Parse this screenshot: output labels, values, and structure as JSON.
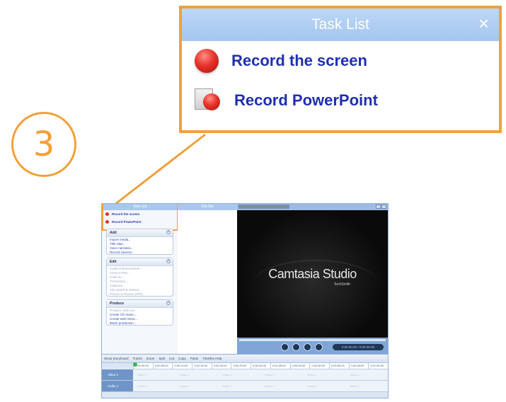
{
  "step": {
    "number": "3"
  },
  "callout": {
    "title": "Task List",
    "close_glyph": "×",
    "tasks": [
      {
        "label": "Record the screen",
        "icon": "record-icon"
      },
      {
        "label": "Record PowerPoint",
        "icon": "powerpoint-record-icon"
      }
    ]
  },
  "colors": {
    "highlight": "#f0a03c",
    "header_blue": "#a6c6ef",
    "task_text": "#1f2fb0",
    "record_red": "#e8312a"
  },
  "app": {
    "task_list_header": "Task List",
    "tasks": [
      "Record the screen",
      "Record PowerPoint"
    ],
    "groups": [
      {
        "title": "Add",
        "items": [
          "Import media...",
          "Title clips...",
          "Voice narration...",
          "Record camera..."
        ]
      },
      {
        "title": "Edit",
        "items": [
          "Audio enhancements...",
          "Zoom-n-Pan...",
          "Callouts...",
          "Transitions...",
          "Captions...",
          "Clip speed & volume...",
          "Picture-in-Picture (PIP)..."
        ]
      },
      {
        "title": "Produce",
        "items": [
          "Produce video as...",
          "Create CD menu...",
          "Create web menu...",
          "Batch production..."
        ]
      }
    ],
    "clip_bin_header": "Clip Bin",
    "preview": {
      "brand": "Camtasia Studio",
      "brand_sub": "TechSmith",
      "timecode": "0:00:00:00 / 0:00:00:00"
    },
    "timeline": {
      "toolbar": [
        "Show Storyboard",
        "Tracks",
        "Zoom",
        "Split",
        "Cut",
        "Copy",
        "Paste",
        "Timeline Help"
      ],
      "ruler": [
        "0:00:00;00",
        "0:00:05;00",
        "0:00:10;00",
        "0:00:15;00",
        "0:00:20;00",
        "0:00:25;00",
        "0:00:30;00",
        "0:00:35;00",
        "0:00:40;00",
        "0:00:45;00",
        "0:00:50;00",
        "0:00:55;00",
        "0:01:00;00"
      ],
      "tracks": [
        {
          "name": "Video 1",
          "lane_label": "Video 1"
        },
        {
          "name": "Audio 1",
          "lane_label": "Audio 1"
        }
      ]
    }
  }
}
